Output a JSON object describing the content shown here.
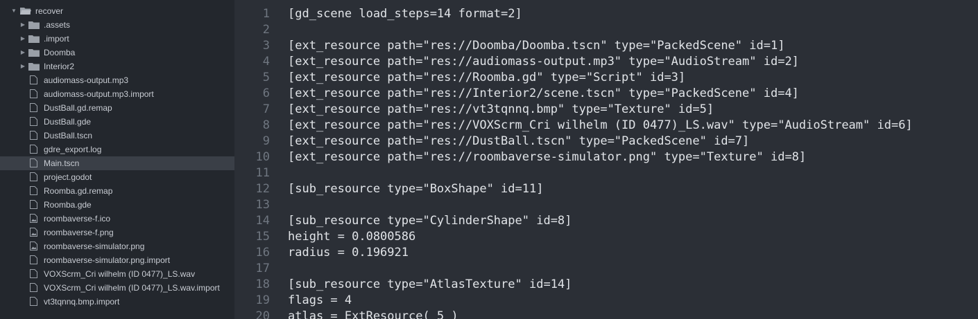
{
  "file_tree": {
    "root": {
      "label": "recover",
      "icon": "folder-open-icon"
    },
    "items": [
      {
        "label": ".assets",
        "icon": "folder-icon"
      },
      {
        "label": ".import",
        "icon": "folder-icon"
      },
      {
        "label": "Doomba",
        "icon": "folder-icon"
      },
      {
        "label": "Interior2",
        "icon": "folder-icon"
      },
      {
        "label": "audiomass-output.mp3",
        "icon": "file-icon"
      },
      {
        "label": "audiomass-output.mp3.import",
        "icon": "file-icon"
      },
      {
        "label": "DustBall.gd.remap",
        "icon": "file-icon"
      },
      {
        "label": "DustBall.gde",
        "icon": "file-icon"
      },
      {
        "label": "DustBall.tscn",
        "icon": "file-icon"
      },
      {
        "label": "gdre_export.log",
        "icon": "file-icon"
      },
      {
        "label": "Main.tscn",
        "icon": "file-icon"
      },
      {
        "label": "project.godot",
        "icon": "file-icon"
      },
      {
        "label": "Roomba.gd.remap",
        "icon": "file-icon"
      },
      {
        "label": "Roomba.gde",
        "icon": "file-icon"
      },
      {
        "label": "roombaverse-f.ico",
        "icon": "image-file-icon"
      },
      {
        "label": "roombaverse-f.png",
        "icon": "image-file-icon"
      },
      {
        "label": "roombaverse-simulator.png",
        "icon": "image-file-icon"
      },
      {
        "label": "roombaverse-simulator.png.import",
        "icon": "file-icon"
      },
      {
        "label": "VOXScrm_Cri wilhelm (ID 0477)_LS.wav",
        "icon": "file-icon"
      },
      {
        "label": "VOXScrm_Cri wilhelm (ID 0477)_LS.wav.import",
        "icon": "file-icon"
      },
      {
        "label": "vt3tqnnq.bmp.import",
        "icon": "file-icon"
      }
    ],
    "selected": "Main.tscn"
  },
  "editor": {
    "lines": [
      {
        "n": "1",
        "text": "[gd_scene load_steps=14 format=2]"
      },
      {
        "n": "2",
        "text": ""
      },
      {
        "n": "3",
        "text": "[ext_resource path=\"res://Doomba/Doomba.tscn\" type=\"PackedScene\" id=1]"
      },
      {
        "n": "4",
        "text": "[ext_resource path=\"res://audiomass-output.mp3\" type=\"AudioStream\" id=2]"
      },
      {
        "n": "5",
        "text": "[ext_resource path=\"res://Roomba.gd\" type=\"Script\" id=3]"
      },
      {
        "n": "6",
        "text": "[ext_resource path=\"res://Interior2/scene.tscn\" type=\"PackedScene\" id=4]"
      },
      {
        "n": "7",
        "text": "[ext_resource path=\"res://vt3tqnnq.bmp\" type=\"Texture\" id=5]"
      },
      {
        "n": "8",
        "text": "[ext_resource path=\"res://VOXScrm_Cri wilhelm (ID 0477)_LS.wav\" type=\"AudioStream\" id=6]"
      },
      {
        "n": "9",
        "text": "[ext_resource path=\"res://DustBall.tscn\" type=\"PackedScene\" id=7]"
      },
      {
        "n": "10",
        "text": "[ext_resource path=\"res://roombaverse-simulator.png\" type=\"Texture\" id=8]"
      },
      {
        "n": "11",
        "text": ""
      },
      {
        "n": "12",
        "text": "[sub_resource type=\"BoxShape\" id=11]"
      },
      {
        "n": "13",
        "text": ""
      },
      {
        "n": "14",
        "text": "[sub_resource type=\"CylinderShape\" id=8]"
      },
      {
        "n": "15",
        "text": "height = 0.0800586"
      },
      {
        "n": "16",
        "text": "radius = 0.196921"
      },
      {
        "n": "17",
        "text": ""
      },
      {
        "n": "18",
        "text": "[sub_resource type=\"AtlasTexture\" id=14]"
      },
      {
        "n": "19",
        "text": "flags = 4"
      },
      {
        "n": "20",
        "text": "atlas = ExtResource( 5 )"
      }
    ]
  },
  "colors": {
    "sidebar_bg": "#23272d",
    "editor_bg": "#2b2f36",
    "selected_row": "#3a3f47",
    "code_text": "#e1e4e8",
    "line_number": "#6f7680",
    "tree_text": "#c8ccd3"
  }
}
